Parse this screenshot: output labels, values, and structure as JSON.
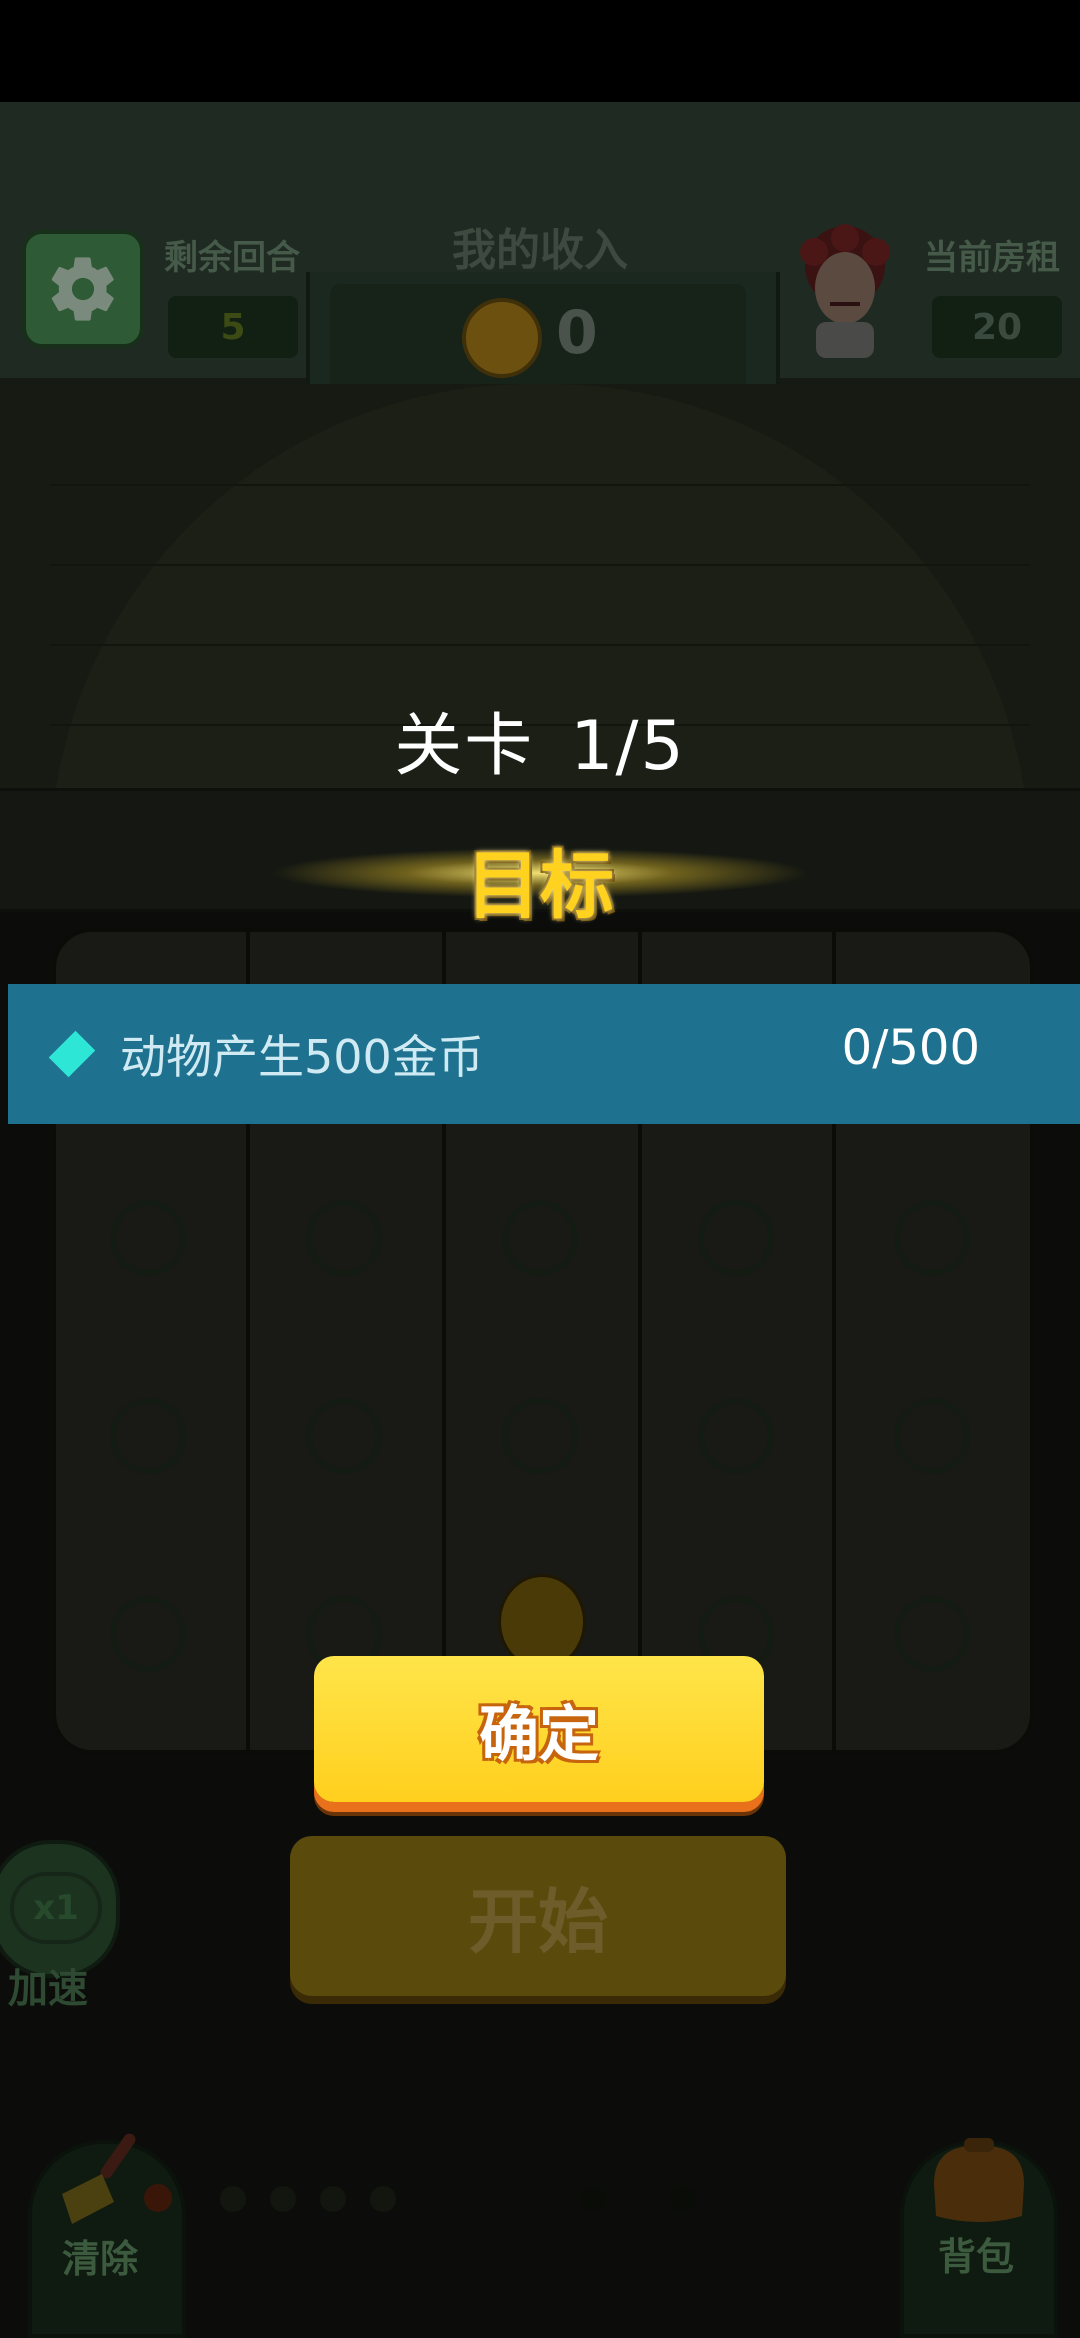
{
  "hud": {
    "rounds_label": "剩余回合",
    "rounds_value": "5",
    "income_label": "我的收入",
    "income_value": "0",
    "rent_label": "当前房租",
    "rent_value": "20"
  },
  "level": {
    "label": "关卡",
    "value": "1/5"
  },
  "target": {
    "title": "目标",
    "objective_text": "动物产生500金币",
    "objective_progress": "0/500"
  },
  "buttons": {
    "confirm": "确定",
    "start": "开始",
    "speed": "x1",
    "speed_label": "加速",
    "clear": "清除",
    "bag": "背包"
  },
  "icons": {
    "settings": "gear-icon",
    "coin": "coin-icon",
    "landlady": "landlady-avatar",
    "objective": "diamond-icon",
    "clear": "brush-icon",
    "bag": "bag-icon"
  },
  "colors": {
    "objective_bar": "#1f728f",
    "confirm_button": "#ffd52a",
    "target_title": "#ffd21f"
  }
}
